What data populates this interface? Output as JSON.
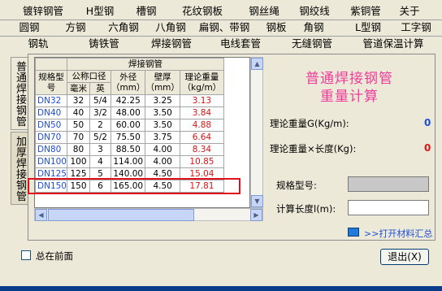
{
  "tabs": {
    "row1": [
      "镀锌钢管",
      "H型钢",
      "槽钢",
      "花纹钢板",
      "钢丝绳",
      "钢绞线",
      "紫铜管",
      "关于"
    ],
    "row2": [
      "圆钢",
      "方钢",
      "六角钢",
      "八角钢",
      "扁钢、带钢",
      "钢板",
      "角钢",
      "L型钢",
      "工字钢"
    ],
    "row3": [
      "钢轨",
      "铸铁管",
      "焊接钢管",
      "电线套管",
      "无缝钢管",
      "管道保温计算"
    ]
  },
  "side_tabs": [
    "普通焊接钢管",
    "加厚焊接钢管"
  ],
  "table": {
    "group_header": "焊接钢管",
    "headers": {
      "spec": "规格型号",
      "nominal": "公称口径",
      "mm": "毫米",
      "inch": "英",
      "od": "外径（mm）",
      "wall": "壁厚（mm）",
      "weight": "理论重量（kg/m）"
    },
    "rows": [
      [
        "DN32",
        "32",
        "5/4",
        "42.25",
        "3.25",
        "3.13"
      ],
      [
        "DN40",
        "40",
        "3/2",
        "48.00",
        "3.50",
        "3.84"
      ],
      [
        "DN50",
        "50",
        "2",
        "60.00",
        "3.50",
        "4.88"
      ],
      [
        "DN70",
        "70",
        "5/2",
        "75.50",
        "3.75",
        "6.64"
      ],
      [
        "DN80",
        "80",
        "3",
        "88.50",
        "4.00",
        "8.34"
      ],
      [
        "DN100",
        "100",
        "4",
        "114.00",
        "4.00",
        "10.85"
      ],
      [
        "DN125",
        "125",
        "5",
        "140.00",
        "4.50",
        "15.04"
      ],
      [
        "DN150",
        "150",
        "6",
        "165.00",
        "4.50",
        "17.81"
      ]
    ],
    "highlighted_row": "DN125"
  },
  "panel": {
    "title_line1": "普通焊接钢管",
    "title_line2": "重量计算",
    "unit_weight_label": "理论重量G(Kg/m):",
    "unit_weight_value": "0",
    "total_weight_label": "理论重量×长度(Kg):",
    "total_weight_value": "0",
    "spec_label": "规格型号:",
    "spec_value": "",
    "length_label": "计算长度l(m):",
    "length_value": "",
    "summary_link": ">>打开材料汇总"
  },
  "footer": {
    "topmost_label": "总在前面",
    "exit_label": "退出(X)"
  },
  "colors": {
    "accent_pink": "#ee3c9a",
    "spec_blue": "#1d4fd6",
    "weight_red": "#d81414",
    "highlight_box": "#e0101c"
  }
}
